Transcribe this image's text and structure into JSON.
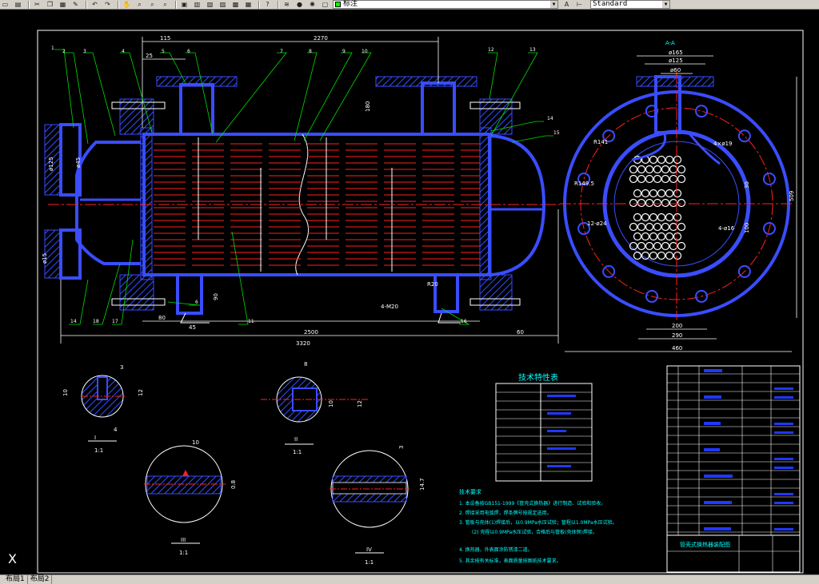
{
  "toolbar": {
    "buttons": [
      {
        "name": "new-icon",
        "glyph": "▭"
      },
      {
        "name": "open-icon",
        "glyph": "▤"
      },
      {
        "name": "cut-icon",
        "glyph": "✂"
      },
      {
        "name": "copy-icon",
        "glyph": "❐"
      },
      {
        "name": "paste-icon",
        "glyph": "▦"
      },
      {
        "name": "match-properties-icon",
        "glyph": "✎"
      },
      {
        "name": "undo-icon",
        "glyph": "↶"
      },
      {
        "name": "redo-icon",
        "glyph": "↷"
      },
      {
        "name": "pan-icon",
        "glyph": "✋"
      },
      {
        "name": "zoom-realtime-icon",
        "glyph": "⌕"
      },
      {
        "name": "zoom-window-icon",
        "glyph": "⌕"
      },
      {
        "name": "zoom-previous-icon",
        "glyph": "⌕"
      },
      {
        "name": "properties-icon",
        "glyph": "▣"
      },
      {
        "name": "design-center-icon",
        "glyph": "▥"
      },
      {
        "name": "tool-palettes-icon",
        "glyph": "▧"
      },
      {
        "name": "sheet-set-icon",
        "glyph": "▨"
      },
      {
        "name": "markup-icon",
        "glyph": "▩"
      },
      {
        "name": "calculator-icon",
        "glyph": "▦"
      },
      {
        "name": "help-icon",
        "glyph": "?"
      }
    ],
    "layer_icons": [
      {
        "name": "layer-manager-icon",
        "glyph": "≋"
      },
      {
        "name": "layer-on-icon",
        "glyph": "●"
      },
      {
        "name": "layer-freeze-icon",
        "glyph": "✺"
      },
      {
        "name": "layer-lock-icon",
        "glyph": "▢"
      }
    ],
    "layer_name": "标注",
    "layer_color": "#00ff00",
    "style_icons": [
      {
        "name": "text-style-icon",
        "glyph": "A"
      },
      {
        "name": "dim-style-icon",
        "glyph": "⊢"
      }
    ],
    "text_style": "Standard"
  },
  "drawing": {
    "dims_main": {
      "d115": "115",
      "d2270": "2270",
      "d25": "25",
      "d180": "180",
      "d80": "80",
      "d45": "45",
      "d90": "90",
      "d2500": "2500",
      "d60": "60",
      "d3320": "3320",
      "d4x20": "4-M20",
      "r20": "R20",
      "d125": "ø125",
      "d45b": "ø45",
      "d415": "ø15"
    },
    "balloons_top": [
      "1",
      "2",
      "3",
      "4",
      "5",
      "6",
      "7",
      "8",
      "9",
      "10",
      "12",
      "13"
    ],
    "balloons_side": [
      "14",
      "15"
    ],
    "balloons_bottom": [
      "14",
      "18",
      "17",
      "6",
      "11",
      "16"
    ],
    "section_title": "A-A",
    "dims_section": {
      "d165": "ø165",
      "d125": "ø125",
      "d60": "ø60",
      "r141": "R141",
      "r1495": "R149.5",
      "n12": "12-ø24",
      "n19": "4×ø19",
      "n4": "4-ø16",
      "d30": "30",
      "d100": "100",
      "d509": "509",
      "d200": "200",
      "d290": "290",
      "d460": "460"
    },
    "details": [
      {
        "label": "I",
        "scale": "1:1",
        "d1": "3",
        "d2": "10",
        "d3": "12",
        "d4": "4"
      },
      {
        "label": "II",
        "scale": "1:1",
        "d1": "8",
        "d2": "10",
        "d3": "12"
      },
      {
        "label": "III",
        "scale": "1:1",
        "d1": "10",
        "d2": "0.8"
      },
      {
        "label": "IV",
        "scale": "1:1",
        "d1": "3",
        "d2": "14.7"
      }
    ],
    "tech_table_title": "技术特性表",
    "notes_title": "技术要求",
    "notes": [
      "1. 本设备按GB151-1999《管壳式换热器》进行制造、试验和验收。",
      "2. 焊接采用电弧焊，焊条牌号按规定选用。",
      "3. 管板与壳体(1)焊接后，以0.9MPa水压试验；管程以1.0MPa水压试验。",
      "(2) 壳程以0.9MPa水压试验，合格后与管板(壳体侧)焊接。",
      "4. 换热器，外表面涂防锈漆二道。",
      "5. 其余按有关标准，表面质量按图纸技术要求。"
    ],
    "title_block": "管壳式换热器装配图"
  },
  "tabs": [
    "布局1",
    "布局2"
  ]
}
